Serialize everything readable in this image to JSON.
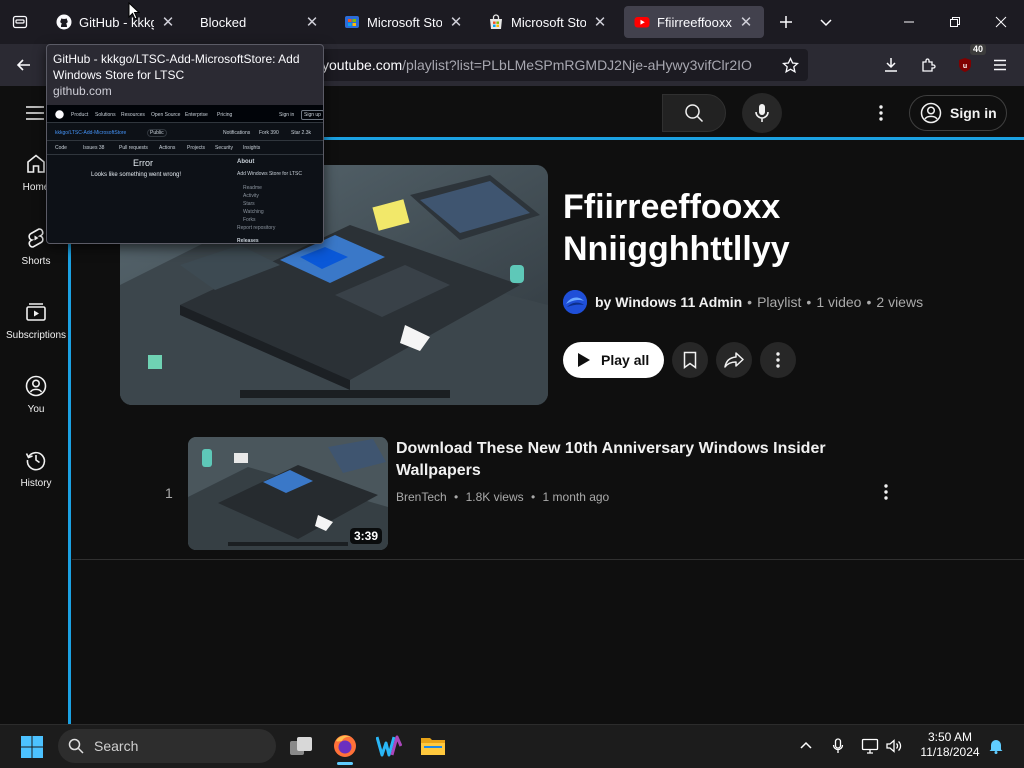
{
  "tabs": [
    {
      "title": "GitHub - kkkgo/LTSC-Add-MicrosoftStore",
      "icon": "github-icon"
    },
    {
      "title": "Blocked",
      "icon": "none"
    },
    {
      "title": "Microsoft Store",
      "icon": "microsoft-store-icon"
    },
    {
      "title": "Microsoft Store",
      "icon": "microsoft-store-bag-icon"
    },
    {
      "title": "Ffiirreeffooxx Nniigghhttllyy",
      "icon": "youtube-icon"
    }
  ],
  "tooltip": {
    "title": "GitHub - kkkgo/LTSC-Add-MicrosoftStore: Add Windows Store for LTSC",
    "host": "github.com",
    "preview": {
      "nav": [
        "Product",
        "Solutions",
        "Resources",
        "Open Source",
        "Enterprise",
        "Pricing"
      ],
      "signin": "Sign in",
      "signup": "Sign up",
      "repo": "kkkgo/LTSC-Add-MicrosoftStore",
      "public": "Public",
      "notifications": "Notifications",
      "fork": "Fork 390",
      "star": "Star 2.3k",
      "subtabs": [
        "Code",
        "Issues 38",
        "Pull requests",
        "Actions",
        "Projects",
        "Security",
        "Insights"
      ],
      "error_title": "Error",
      "error_msg": "Looks like something went wrong!",
      "about_title": "About",
      "about_desc": "Add Windows Store for LTSC",
      "about_items": [
        "Readme",
        "Activity",
        "Stars",
        "Watching",
        "Forks",
        "Report repository"
      ],
      "releases": "Releases"
    }
  },
  "address": {
    "host": "youtube.com",
    "rest": "/playlist?list=PLbLMeSPmRGMDJ2Nje-aHywy3vifClr2IO"
  },
  "extension_badge": "40",
  "youtube": {
    "signin_label": "Sign in",
    "guide": [
      {
        "label": "Home",
        "icon": "home-icon"
      },
      {
        "label": "Shorts",
        "icon": "shorts-icon"
      },
      {
        "label": "Subscriptions",
        "icon": "subscriptions-icon"
      },
      {
        "label": "You",
        "icon": "you-icon"
      },
      {
        "label": "History",
        "icon": "history-icon"
      }
    ],
    "playlist": {
      "title": "Ffiirreeffooxx Nniigghhttllyy",
      "owner": "by Windows 11 Admin",
      "type": "Playlist",
      "videos": "1 video",
      "views": "2 views",
      "sep": "•",
      "play_all": "Play all"
    },
    "videos": [
      {
        "index": "1",
        "title": "Download These New 10th Anniversary Windows Insider Wallpapers",
        "channel": "BrenTech",
        "views": "1.8K views",
        "age": "1 month ago",
        "duration": "3:39"
      }
    ]
  },
  "taskbar": {
    "search_label": "Search",
    "apps": [
      "task-view-icon",
      "firefox-icon",
      "wps-icon",
      "file-explorer-icon"
    ],
    "time": "3:50 AM",
    "date": "11/18/2024"
  },
  "colors": {
    "accent_cyan": "#1ba1e2",
    "youtube_red": "#ff0000",
    "bg": "#0f0f0f"
  }
}
